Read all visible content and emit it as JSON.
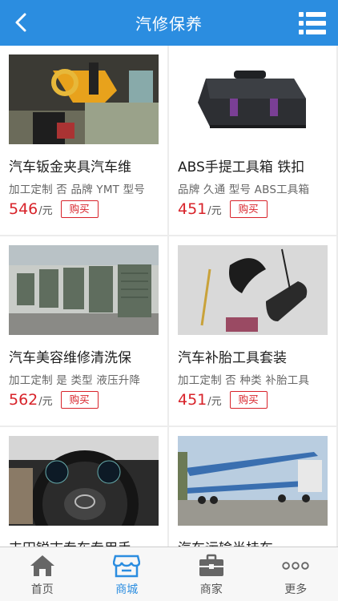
{
  "header": {
    "title": "汽修保养"
  },
  "products": [
    {
      "name": "汽车钣金夹具汽车维",
      "spec": "加工定制 否 品牌 YMT 型号",
      "price": "546",
      "unit": "/元",
      "buy_label": "购买"
    },
    {
      "name": "ABS手提工具箱 铁扣",
      "spec": "品牌 久通 型号 ABS工具箱",
      "price": "451",
      "unit": "/元",
      "buy_label": "购买"
    },
    {
      "name": "汽车美容维修清洗保",
      "spec": "加工定制 是 类型 液压升降",
      "price": "562",
      "unit": "/元",
      "buy_label": "购买"
    },
    {
      "name": "汽车补胎工具套装",
      "spec": "加工定制 否 种类 补胎工具",
      "price": "451",
      "unit": "/元",
      "buy_label": "购买"
    },
    {
      "name": "丰田锐志专车专用手",
      "spec": "",
      "price": "",
      "unit": "",
      "buy_label": ""
    },
    {
      "name": "汽车运输半挂车",
      "spec": "",
      "price": "",
      "unit": "",
      "buy_label": ""
    }
  ],
  "tabbar": [
    {
      "label": "首页",
      "icon": "home-icon",
      "active": false
    },
    {
      "label": "商城",
      "icon": "store-icon",
      "active": true
    },
    {
      "label": "商家",
      "icon": "briefcase-icon",
      "active": false
    },
    {
      "label": "更多",
      "icon": "more-icon",
      "active": false
    }
  ],
  "colors": {
    "brand": "#2b8de0",
    "price": "#d8232a",
    "background": "#ececec"
  }
}
